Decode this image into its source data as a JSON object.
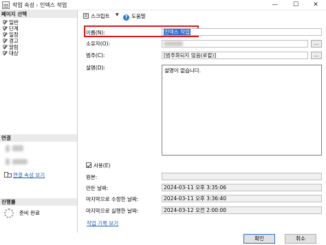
{
  "window": {
    "title": "작업 속성 - 인덱스 작업",
    "minimize": "—",
    "maximize": "☐",
    "close": "✕"
  },
  "left_pane": {
    "pages_header": "페이지 선택",
    "pages": [
      "일반",
      "단계",
      "일정",
      "경고",
      "알림",
      "대상"
    ],
    "connection_header": "연결",
    "connection_link": "연결 속성 보기",
    "progress_header": "진행률",
    "progress_status": "준비 완료"
  },
  "toolbar": {
    "script_label": "스크립트",
    "dropdown_arrow": "▼",
    "help_label": "도움말",
    "help_glyph": "?"
  },
  "form": {
    "name_label": "이름(N):",
    "name_value": "인덱스 작업",
    "owner_label": "소유자(O):",
    "category_label": "범주(C):",
    "category_value": "[범주화되지 않음(로컬)]",
    "description_label": "설명(D):",
    "description_value": "설명이 없습니다.",
    "enabled_label": "사용(E)",
    "enabled_checked": true,
    "source_label": "원본:",
    "created_label": "만든 날짜:",
    "created_value": "2024-03-11 오후 3:35:06",
    "modified_label": "마지막으로 수정한 날짜:",
    "modified_value": "2024-03-11 오후 3:36:40",
    "executed_label": "마지막으로 실행한 날짜:",
    "executed_value": "2024-03-12 오전 2:00:00",
    "history_link": "작업 기록 보기",
    "browse_label": "..."
  },
  "buttons": {
    "ok": "확인",
    "cancel": "취소"
  },
  "colors": {
    "highlight": "#e0141d",
    "selection": "#2f6fd0",
    "link": "#1a5fb4"
  }
}
